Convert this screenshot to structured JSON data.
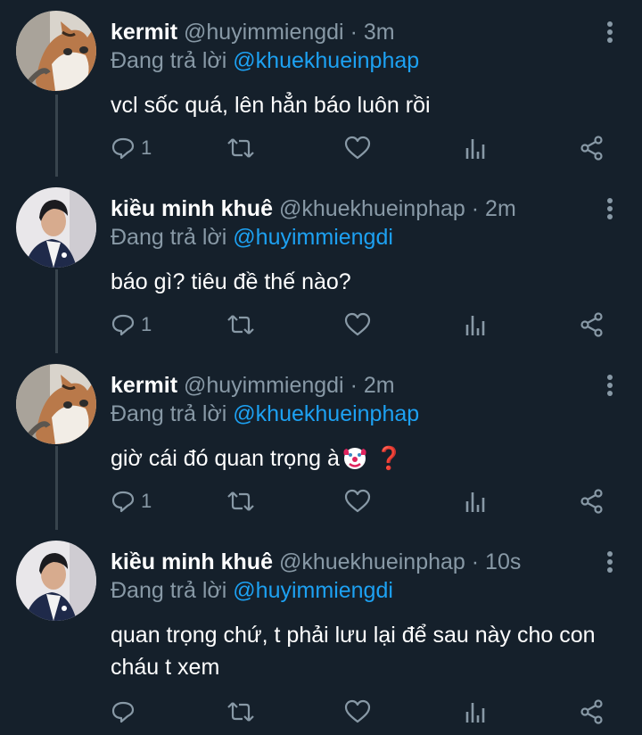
{
  "colors": {
    "background": "#15202b",
    "muted": "#8899a6",
    "link": "#1da1f2",
    "thread_line": "#38444d"
  },
  "tweets": [
    {
      "name": "kermit",
      "handle": "@huyimmiengdi",
      "time": "3m",
      "replying_prefix": "Đang trả lời",
      "replying_to": "@khuekhueinphap",
      "text": "vcl sốc quá, lên hẳn báo luôn rồi",
      "reply_count": "1",
      "avatar": "cat-avatar"
    },
    {
      "name": "kiều minh khuê",
      "handle": "@khuekhueinphap",
      "time": "2m",
      "replying_prefix": "Đang trả lời",
      "replying_to": "@huyimmiengdi",
      "text": "báo gì? tiêu đề thế nào?",
      "reply_count": "1",
      "avatar": "man-avatar"
    },
    {
      "name": "kermit",
      "handle": "@huyimmiengdi",
      "time": "2m",
      "replying_prefix": "Đang trả lời",
      "replying_to": "@khuekhueinphap",
      "text": "giờ cái đó quan trọng à",
      "emoji_question": "❓",
      "reply_count": "1",
      "avatar": "cat-avatar"
    },
    {
      "name": "kiều minh khuê",
      "handle": "@khuekhueinphap",
      "time": "10s",
      "replying_prefix": "Đang trả lời",
      "replying_to": "@huyimmiengdi",
      "text": "quan trọng chứ, t phải lưu lại để sau này cho con cháu t xem",
      "reply_count": "",
      "avatar": "man-avatar"
    }
  ]
}
